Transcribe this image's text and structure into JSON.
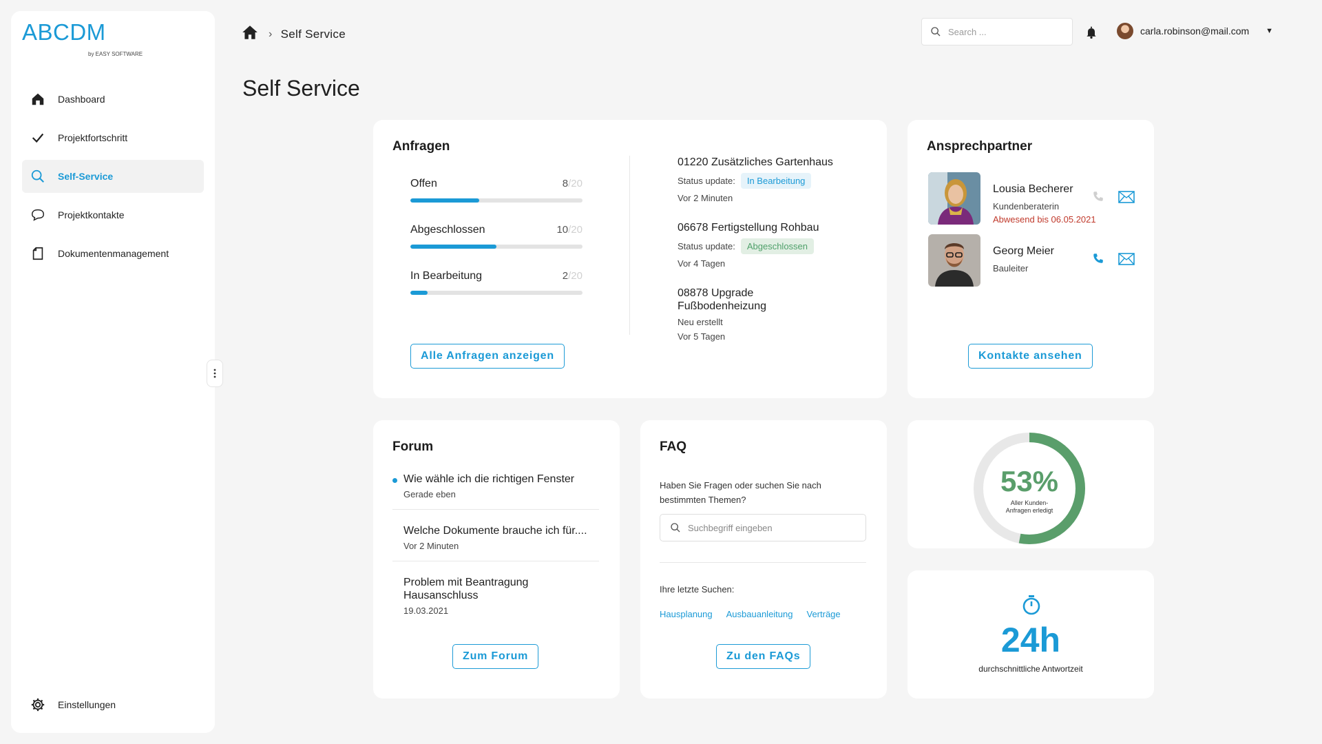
{
  "brand": {
    "name": "ABCDM",
    "sub": "by EASY SOFTWARE",
    "color": "#1b9ad6"
  },
  "sidebar": {
    "items": [
      {
        "label": "Dashboard",
        "icon": "home-icon"
      },
      {
        "label": "Projektfortschritt",
        "icon": "checkmark-icon"
      },
      {
        "label": "Self-Service",
        "icon": "search-icon",
        "active": true
      },
      {
        "label": "Projektkontakte",
        "icon": "chat-bubble-icon"
      },
      {
        "label": "Dokumentenmanagement",
        "icon": "document-icon"
      }
    ],
    "settings_label": "Einstellungen"
  },
  "header": {
    "breadcrumb_current": "Self Service",
    "search_placeholder": "Search ...",
    "user_email": "carla.robinson@mail.com"
  },
  "page_title": "Self Service",
  "anfragen": {
    "title": "Anfragen",
    "stats": [
      {
        "label": "Offen",
        "count": "8",
        "total": "/20",
        "progress": 0.4
      },
      {
        "label": "Abgeschlossen",
        "count": "10",
        "total": "/20",
        "progress": 0.5
      },
      {
        "label": "In Bearbeitung",
        "count": "2",
        "total": "/20",
        "progress": 0.1
      }
    ],
    "requests": [
      {
        "title": "01220 Zusätzliches Gartenhaus",
        "status_prefix": "Status update:",
        "status": "In Bearbeitung",
        "age": "Vor 2 Minuten"
      },
      {
        "title": "06678 Fertigstellung Rohbau",
        "status_prefix": "Status update:",
        "status": "Abgeschlossen",
        "age": "Vor 4 Tagen"
      },
      {
        "title": "08878 Upgrade Fußbodenheizung",
        "status_text": "Neu erstellt",
        "age": "Vor 5 Tagen"
      }
    ],
    "button": "Alle Anfragen anzeigen"
  },
  "contacts": {
    "title": "Ansprechpartner",
    "people": [
      {
        "name": "Lousia Becherer",
        "role": "Kundenberaterin",
        "away": "Abwesend bis 06.05.2021"
      },
      {
        "name": "Georg Meier",
        "role": "Bauleiter"
      }
    ],
    "button": "Kontakte ansehen"
  },
  "forum": {
    "title": "Forum",
    "items": [
      {
        "title": "Wie wähle ich die richtigen Fenster",
        "date": "Gerade eben",
        "unread": true
      },
      {
        "title": "Welche Dokumente brauche ich für....",
        "date": "Vor 2 Minuten"
      },
      {
        "title": "Problem mit Beantragung Hausanschluss",
        "date": "19.03.2021"
      }
    ],
    "button": "Zum Forum"
  },
  "faq": {
    "title": "FAQ",
    "text": "Haben Sie Fragen oder suchen Sie nach bestimmten Themen?",
    "search_placeholder": "Suchbegriff eingeben",
    "recent_label": "Ihre letzte Suchen:",
    "tags": [
      "Hausplanung",
      "Ausbauanleitung",
      "Verträge"
    ],
    "button": "Zu den FAQs"
  },
  "kpi": {
    "percent": "53%",
    "percent_value": 0.53,
    "percent_label": "Aller Kunden-Anfragen erledigt",
    "response_time": "24h",
    "response_label": "durchschnittliche Antwortzeit",
    "green": "#5a9e6b"
  }
}
